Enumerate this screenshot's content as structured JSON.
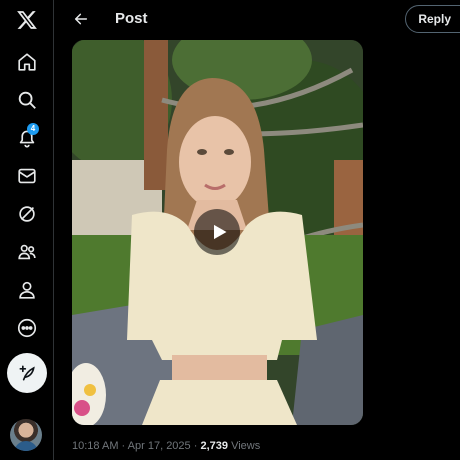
{
  "header": {
    "title": "Post",
    "reply_label": "Reply"
  },
  "nav": {
    "notifications_badge": "4",
    "items": [
      "x-logo-icon",
      "home-icon",
      "explore-icon",
      "notifications-icon",
      "messages-icon",
      "grok-icon",
      "communities-icon",
      "profile-icon",
      "more-icon"
    ]
  },
  "post": {
    "time": "10:18 AM",
    "separator": "·",
    "date": "Apr 17, 2025",
    "views_count": "2,739",
    "views_label": "Views"
  },
  "colors": {
    "accent": "#1d9bf0",
    "background": "#000000",
    "text_secondary": "#71767b"
  }
}
